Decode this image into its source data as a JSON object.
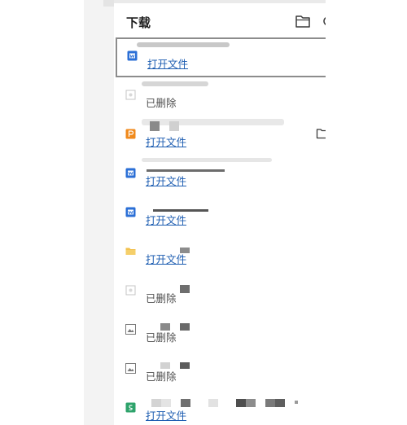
{
  "panel": {
    "title": "下载"
  },
  "items": [
    {
      "status": "打开文件",
      "file_type": "word"
    },
    {
      "status": "已删除",
      "file_type": "deleted"
    },
    {
      "status": "打开文件",
      "file_type": "ppt"
    },
    {
      "status": "打开文件",
      "file_type": "word"
    },
    {
      "status": "打开文件",
      "file_type": "word"
    },
    {
      "status": "打开文件",
      "file_type": "folder"
    },
    {
      "status": "已删除",
      "file_type": "deleted"
    },
    {
      "status": "已删除",
      "file_type": "image"
    },
    {
      "status": "已删除",
      "file_type": "image"
    },
    {
      "status": "打开文件",
      "file_type": "sheet"
    }
  ],
  "colors": {
    "link": "#1d5db1",
    "word": "#2b6fd6",
    "ppt": "#f08a1c",
    "folder": "#f2c14e",
    "sheet": "#2ea36b"
  }
}
